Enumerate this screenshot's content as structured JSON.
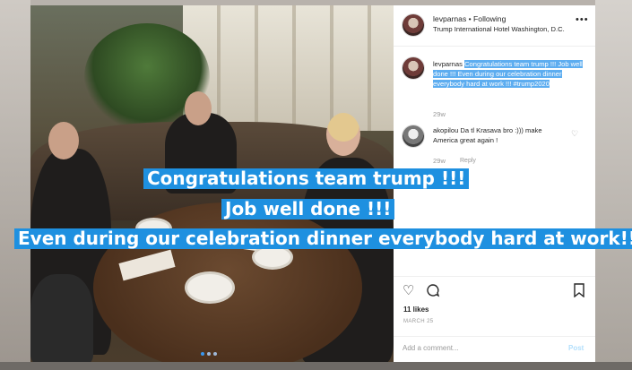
{
  "post": {
    "username": "levparnas",
    "follow_status": "• Following",
    "location": "Trump International Hotel Washington, D.C.",
    "more_icon": "ellipsis-icon"
  },
  "caption": {
    "username": "levparnas",
    "text": "Congratulations team trump !!! Job well done !!! Even during our celebration dinner everybody hard at work !!! #trump2020",
    "time": "29w"
  },
  "comments": [
    {
      "username": "akopilou",
      "text": "Da tl Krasava bro :))) make America great again !",
      "time": "29w",
      "reply_label": "Reply"
    }
  ],
  "actions": {
    "likes": "11 likes",
    "date": "MARCH 25",
    "add_comment_placeholder": "Add a comment...",
    "post_label": "Post"
  },
  "overlay_text": {
    "line1": "Congratulations team trump !!!",
    "line2": "Job well done !!!",
    "line3": "Even during our celebration dinner everybody hard at work!!!"
  },
  "colors": {
    "highlight": "#5dadf0",
    "overlay_bg": "#1e90e0",
    "link_blue": "#3897f0"
  }
}
